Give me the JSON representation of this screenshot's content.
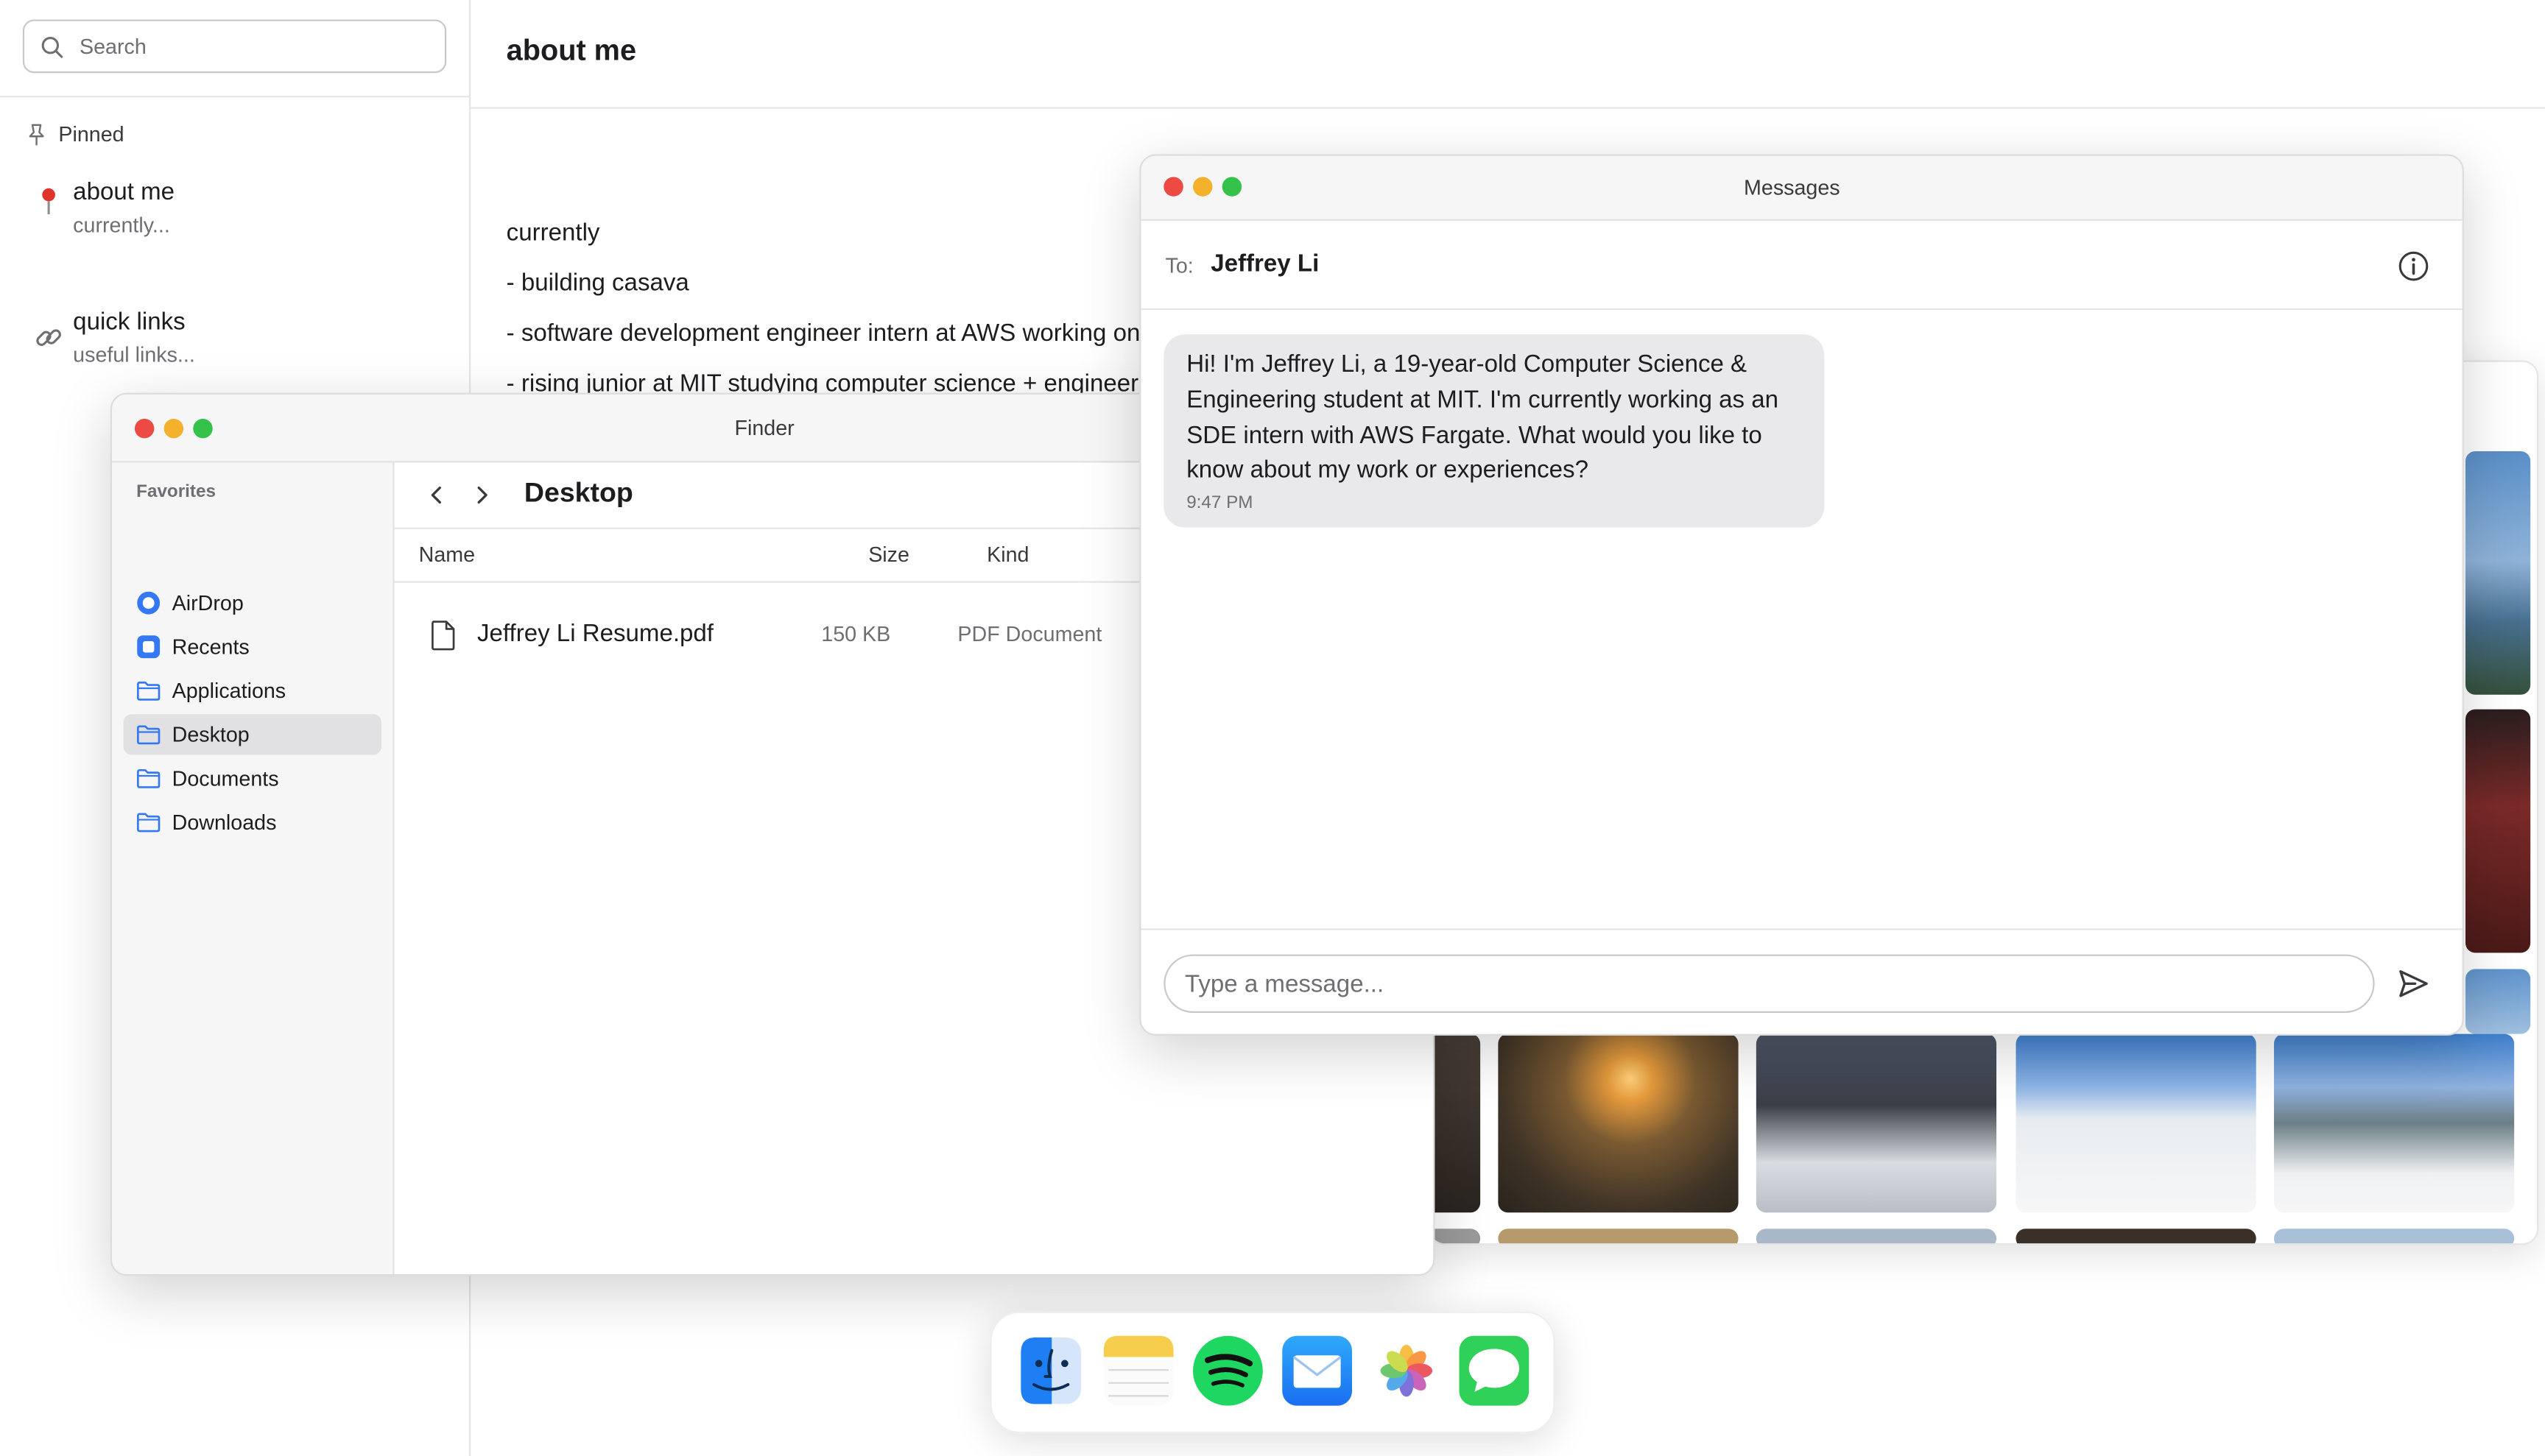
{
  "notes": {
    "search_placeholder": "Search",
    "pinned_label": "Pinned",
    "items": [
      {
        "title": "about me",
        "subtitle": "currently...",
        "icon": "pushpin-icon"
      },
      {
        "title": "quick links",
        "subtitle": "useful links...",
        "icon": "link-icon"
      }
    ],
    "header_title": "about me",
    "body_lines": [
      "currently",
      "- building casava",
      "- software development engineer intern at AWS working on",
      "- rising junior at MIT studying computer science + engineeri"
    ]
  },
  "finder": {
    "title": "Finder",
    "favorites_label": "Favorites",
    "favorites": [
      {
        "label": "AirDrop",
        "icon": "airdrop-icon"
      },
      {
        "label": "Recents",
        "icon": "recents-icon"
      },
      {
        "label": "Applications",
        "icon": "folder-icon"
      },
      {
        "label": "Desktop",
        "icon": "folder-icon",
        "selected": true
      },
      {
        "label": "Documents",
        "icon": "folder-icon"
      },
      {
        "label": "Downloads",
        "icon": "folder-icon"
      }
    ],
    "location": "Desktop",
    "columns": {
      "name": "Name",
      "size": "Size",
      "kind": "Kind"
    },
    "files": [
      {
        "name": "Jeffrey Li Resume.pdf",
        "size": "150 KB",
        "kind": "PDF Document",
        "icon": "document-icon"
      }
    ]
  },
  "messages": {
    "title": "Messages",
    "to_label": "To:",
    "recipient": "Jeffrey Li",
    "bubble_text": "Hi! I'm Jeffrey Li, a 19-year-old Computer Science & Engineering student at MIT. I'm currently working as an SDE intern with AWS Fargate. What would you like to know about my work or experiences?",
    "bubble_time": "9:47 PM",
    "compose_placeholder": "Type a message..."
  },
  "dock": {
    "apps": [
      "finder-icon",
      "notes-icon",
      "spotify-icon",
      "mail-icon",
      "photos-icon",
      "messages-icon"
    ]
  },
  "colors": {
    "traffic_red": "#ed4a43",
    "traffic_yellow": "#f3b12c",
    "traffic_green": "#35c24b",
    "accent_blue": "#3478f6",
    "pin_red": "#e0342b"
  }
}
